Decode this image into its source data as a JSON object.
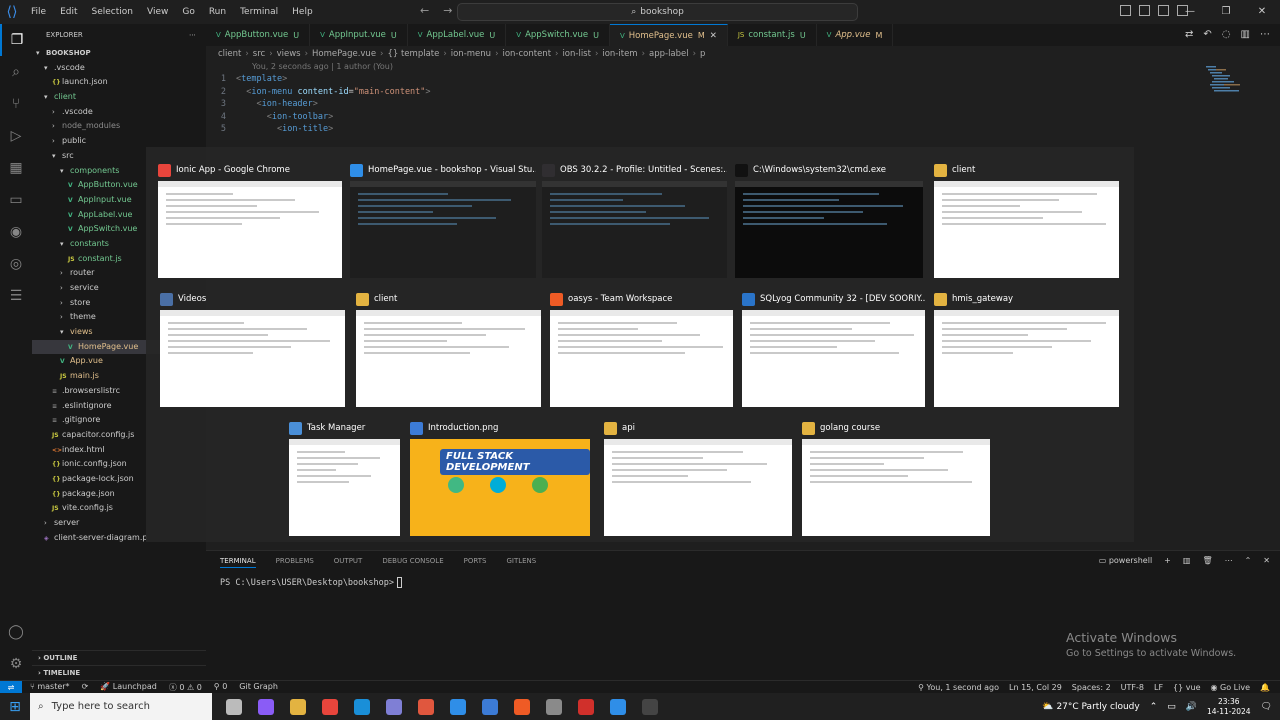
{
  "titlebar": {
    "menu": [
      "File",
      "Edit",
      "Selection",
      "View",
      "Go",
      "Run",
      "Terminal",
      "Help"
    ],
    "search": "bookshop"
  },
  "sidebar": {
    "header": "EXPLORER",
    "root": "BOOKSHOP",
    "items": [
      {
        "label": ".vscode",
        "type": "folder-open",
        "depth": 1
      },
      {
        "label": "launch.json",
        "type": "json",
        "depth": 2
      },
      {
        "label": "client",
        "type": "folder-open",
        "depth": 1,
        "git": "green"
      },
      {
        "label": ".vscode",
        "type": "folder",
        "depth": 2
      },
      {
        "label": "node_modules",
        "type": "folder",
        "depth": 2,
        "muted": true
      },
      {
        "label": "public",
        "type": "folder",
        "depth": 2
      },
      {
        "label": "src",
        "type": "folder-open",
        "depth": 2
      },
      {
        "label": "components",
        "type": "folder-open",
        "depth": 3,
        "git": "green"
      },
      {
        "label": "AppButton.vue",
        "type": "vue",
        "depth": 4,
        "git": "green"
      },
      {
        "label": "AppInput.vue",
        "type": "vue",
        "depth": 4,
        "git": "green"
      },
      {
        "label": "AppLabel.vue",
        "type": "vue",
        "depth": 4,
        "git": "green"
      },
      {
        "label": "AppSwitch.vue",
        "type": "vue",
        "depth": 4,
        "git": "green"
      },
      {
        "label": "constants",
        "type": "folder-open",
        "depth": 3,
        "git": "green"
      },
      {
        "label": "constant.js",
        "type": "js",
        "depth": 4,
        "git": "green"
      },
      {
        "label": "router",
        "type": "folder",
        "depth": 3
      },
      {
        "label": "service",
        "type": "folder",
        "depth": 3
      },
      {
        "label": "store",
        "type": "folder",
        "depth": 3
      },
      {
        "label": "theme",
        "type": "folder",
        "depth": 3
      },
      {
        "label": "views",
        "type": "folder-open",
        "depth": 3,
        "git": "yellow"
      },
      {
        "label": "HomePage.vue",
        "type": "vue",
        "depth": 4,
        "git": "yellow",
        "selected": true
      },
      {
        "label": "App.vue",
        "type": "vue",
        "depth": 3,
        "git": "yellow"
      },
      {
        "label": "main.js",
        "type": "js",
        "depth": 3,
        "git": "yellow"
      },
      {
        "label": ".browserslistrc",
        "type": "file",
        "depth": 2
      },
      {
        "label": ".eslintignore",
        "type": "file",
        "depth": 2
      },
      {
        "label": ".gitignore",
        "type": "file",
        "depth": 2
      },
      {
        "label": "capacitor.config.js",
        "type": "js",
        "depth": 2
      },
      {
        "label": "index.html",
        "type": "html",
        "depth": 2
      },
      {
        "label": "ionic.config.json",
        "type": "json",
        "depth": 2
      },
      {
        "label": "package-lock.json",
        "type": "json",
        "depth": 2
      },
      {
        "label": "package.json",
        "type": "json",
        "depth": 2
      },
      {
        "label": "vite.config.js",
        "type": "js",
        "depth": 2
      },
      {
        "label": "server",
        "type": "folder",
        "depth": 1
      },
      {
        "label": "client-server-diagram.p",
        "type": "diagram",
        "depth": 1
      }
    ],
    "outline": "OUTLINE",
    "timeline": "TIMELINE"
  },
  "tabs": [
    {
      "label": "AppButton.vue",
      "status": "U"
    },
    {
      "label": "AppInput.vue",
      "status": "U"
    },
    {
      "label": "AppLabel.vue",
      "status": "U"
    },
    {
      "label": "AppSwitch.vue",
      "status": "U"
    },
    {
      "label": "HomePage.vue",
      "status": "M",
      "active": true
    },
    {
      "label": "constant.js",
      "status": "U"
    },
    {
      "label": "App.vue",
      "status": "M"
    }
  ],
  "breadcrumb": [
    "client",
    "src",
    "views",
    "HomePage.vue",
    "{} template",
    "ion-menu",
    "ion-content",
    "ion-list",
    "ion-item",
    "app-label",
    "p"
  ],
  "editor": {
    "blame": "You, 2 seconds ago | 1 author (You)",
    "lines": [
      {
        "n": "1",
        "indent": "",
        "tag": "template",
        "attr": "",
        "val": ""
      },
      {
        "n": "2",
        "indent": "  ",
        "tag": "ion-menu",
        "attr": "content-id",
        "val": "\"main-content\""
      },
      {
        "n": "3",
        "indent": "    ",
        "tag": "ion-header",
        "attr": "",
        "val": ""
      },
      {
        "n": "4",
        "indent": "      ",
        "tag": "ion-toolbar",
        "attr": "",
        "val": ""
      },
      {
        "n": "5",
        "indent": "        ",
        "tag": "ion-title",
        "attr": "",
        "val": ""
      }
    ]
  },
  "switcher": {
    "windows": [
      {
        "title": "Ionic App - Google Chrome",
        "app": "chrome",
        "theme": "light"
      },
      {
        "title": "HomePage.vue - bookshop - Visual Stu...",
        "app": "vscode",
        "theme": "dark"
      },
      {
        "title": "OBS 30.2.2 - Profile: Untitled - Scenes:...",
        "app": "obs",
        "theme": "dark"
      },
      {
        "title": "C:\\Windows\\system32\\cmd.exe",
        "app": "cmd",
        "theme": "black"
      },
      {
        "title": "client",
        "app": "folder",
        "theme": "light"
      },
      {
        "title": "Videos",
        "app": "videos",
        "theme": "light"
      },
      {
        "title": "client",
        "app": "folder",
        "theme": "light"
      },
      {
        "title": "oasys - Team Workspace",
        "app": "postman",
        "theme": "light"
      },
      {
        "title": "SQLyog Community 32 - [DEV SOORIY...",
        "app": "sqlyog",
        "theme": "light"
      },
      {
        "title": "hmis_gateway",
        "app": "folder",
        "theme": "light"
      },
      {
        "title": "Task Manager",
        "app": "taskmgr",
        "theme": "light"
      },
      {
        "title": "Introduction.png",
        "app": "photos",
        "theme": "banner",
        "banner": "FULL STACK DEVELOPMENT"
      },
      {
        "title": "api",
        "app": "folder",
        "theme": "light"
      },
      {
        "title": "golang course",
        "app": "folder",
        "theme": "light"
      }
    ]
  },
  "panel": {
    "tabs": [
      "TERMINAL",
      "PROBLEMS",
      "OUTPUT",
      "DEBUG CONSOLE",
      "PORTS",
      "GITLENS"
    ],
    "prompt": "PS C:\\Users\\USER\\Desktop\\bookshop>",
    "shell": "powershell"
  },
  "activate": {
    "title": "Activate Windows",
    "subtitle": "Go to Settings to activate Windows."
  },
  "statusbar": {
    "branch": "master*",
    "launchpad": "Launchpad",
    "problems": "0 ⚠ 0",
    "ports": "0",
    "gitgraph": "Git Graph",
    "blame": "You, 1 second ago",
    "position": "Ln 15, Col 29",
    "spaces": "Spaces: 2",
    "encoding": "UTF-8",
    "eol": "LF",
    "lang": "vue",
    "golive": "Go Live"
  },
  "taskbar": {
    "search": "Type here to search",
    "weather": "27°C  Partly cloudy",
    "time": "23:36",
    "date": "14-11-2024"
  }
}
